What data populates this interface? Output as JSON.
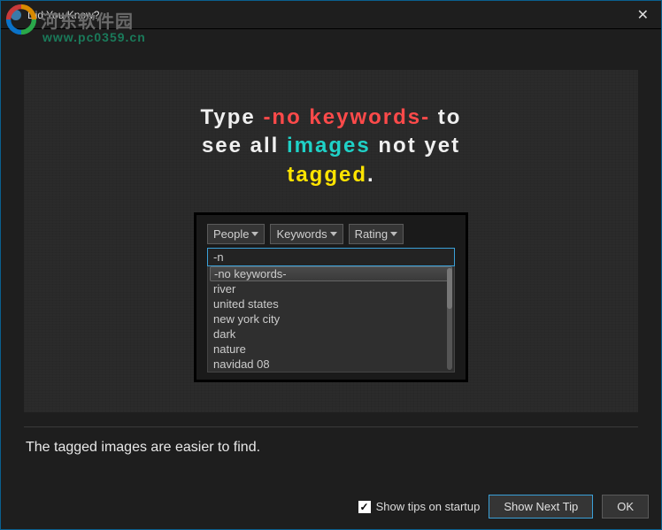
{
  "window": {
    "title": "Did You Know?"
  },
  "watermark": {
    "cn": "河东软件园",
    "url": "www.pc0359.cn"
  },
  "headline": {
    "parts": [
      {
        "t": "Type ",
        "c": "c-white"
      },
      {
        "t": "-no keywords-",
        "c": "c-red"
      },
      {
        "t": " to",
        "c": "c-white"
      },
      {
        "br": true
      },
      {
        "t": "see all ",
        "c": "c-white"
      },
      {
        "t": "images",
        "c": "c-teal"
      },
      {
        "t": " not yet",
        "c": "c-white"
      },
      {
        "br": true
      },
      {
        "t": "tagged",
        "c": "c-yellow"
      },
      {
        "t": ".",
        "c": "c-white"
      }
    ]
  },
  "filters": {
    "people": "People",
    "keywords": "Keywords",
    "rating": "Rating"
  },
  "search": {
    "value": "-n"
  },
  "dropdown": {
    "items": [
      {
        "label": "-no keywords-",
        "selected": true
      },
      {
        "label": "river"
      },
      {
        "label": "united states"
      },
      {
        "label": "new york city"
      },
      {
        "label": "dark"
      },
      {
        "label": "nature"
      },
      {
        "label": "navidad 08"
      }
    ]
  },
  "caption": "The tagged images are easier to find.",
  "footer": {
    "showTips": "Show tips on startup",
    "next": "Show Next Tip",
    "ok": "OK"
  }
}
